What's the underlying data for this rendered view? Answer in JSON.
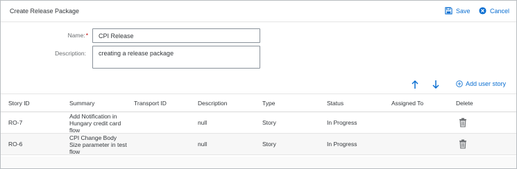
{
  "header": {
    "title": "Create Release Package",
    "save_label": "Save",
    "cancel_label": "Cancel"
  },
  "form": {
    "name_label": "Name:",
    "required_marker": "*",
    "name_value": "CPI Release",
    "description_label": "Description:",
    "description_value": "creating a release package"
  },
  "toolbar": {
    "add_user_story_label": "Add user story"
  },
  "table": {
    "columns": [
      "Story ID",
      "Summary",
      "Transport ID",
      "Description",
      "Type",
      "Status",
      "Assigned To",
      "Delete"
    ],
    "rows": [
      {
        "story_id": "RO-7",
        "summary": "Add Notification in Hungary credit card flow",
        "transport_id": "",
        "description": "null",
        "type": "Story",
        "status": "In Progress",
        "assigned_to": ""
      },
      {
        "story_id": "RO-6",
        "summary": "CPI Change Body Size parameter in test flow",
        "transport_id": "",
        "description": "null",
        "type": "Story",
        "status": "In Progress",
        "assigned_to": ""
      }
    ]
  },
  "colors": {
    "accent": "#0a6ed1",
    "required": "#bb0000",
    "text": "#32363a"
  },
  "icons": {
    "save": "save-icon",
    "cancel": "cancel-circle-icon",
    "move_up": "arrow-up-icon",
    "move_down": "arrow-down-icon",
    "add": "add-circle-icon",
    "delete": "trash-icon"
  }
}
